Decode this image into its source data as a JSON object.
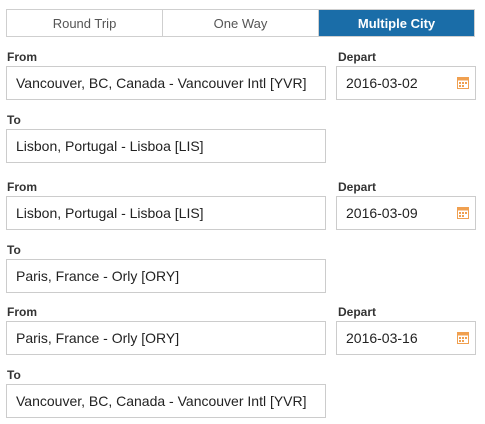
{
  "trip_tabs": [
    {
      "label": "Round Trip",
      "active": false
    },
    {
      "label": "One Way",
      "active": false
    },
    {
      "label": "Multiple City",
      "active": true
    }
  ],
  "accent_color": "#1a6da8",
  "calendar_icon_color": "#f0a050",
  "labels": {
    "from": "From",
    "to": "To",
    "depart": "Depart"
  },
  "legs": [
    {
      "from": "Vancouver, BC, Canada - Vancouver Intl [YVR]",
      "to": "Lisbon, Portugal - Lisboa [LIS]",
      "depart": "2016-03-02"
    },
    {
      "from": "Lisbon, Portugal - Lisboa [LIS]",
      "to": "Paris, France - Orly [ORY]",
      "depart": "2016-03-09"
    },
    {
      "from": "Paris, France - Orly [ORY]",
      "to": "Vancouver, BC, Canada - Vancouver Intl [YVR]",
      "depart": "2016-03-16"
    }
  ]
}
